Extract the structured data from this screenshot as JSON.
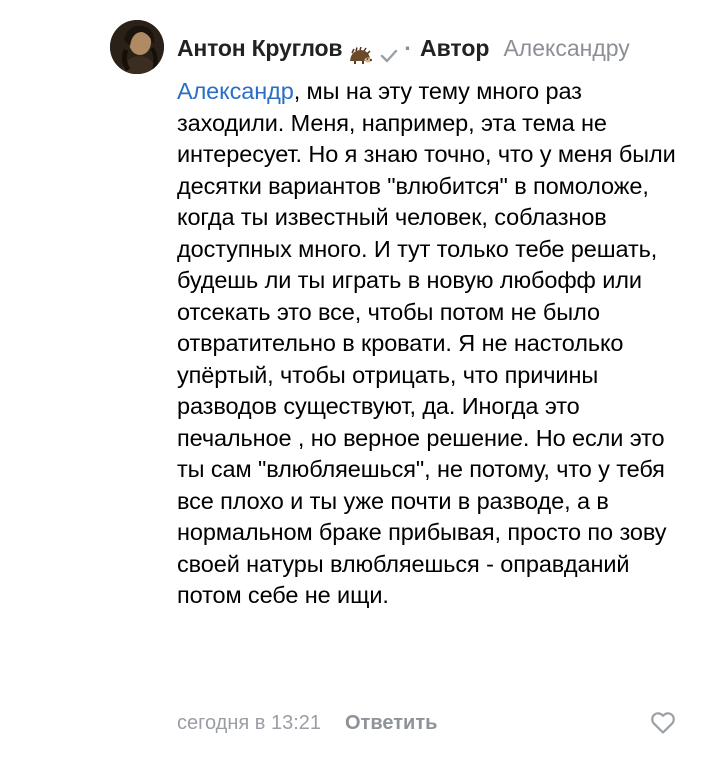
{
  "comment": {
    "author": "Антон Круглов",
    "author_badge": "Автор",
    "reply_to": "Александру",
    "mention": "Александр",
    "text": ", мы на эту тему много раз заходили. Меня, например, эта тема не интересует. Но я знаю точно, что у меня были десятки вариантов \"влюбится\" в помоложе, когда ты известный человек, соблазнов доступных много. И тут только тебе решать, будешь ли ты играть в новую любофф или отсекать это все, чтобы потом не было отвратительно в кровати. Я не настолько упёртый, чтобы отрицать, что причины разводов существуют, да. Иногда это печальное , но верное решение. Но если это ты   сам \"влюбляешься\", не потому, что у тебя все плохо и ты уже почти в разводе, а в нормальном браке прибывая, просто по зову своей натуры влюбляешься - оправданий потом себе не ищи.",
    "timestamp": "сегодня в 13:21",
    "reply_label": "Ответить"
  },
  "icons": {
    "avatar": "avatar",
    "hedgehog": "hedgehog-emoji-icon",
    "verified": "verified-check-icon",
    "like": "heart-outline-icon"
  },
  "colors": {
    "link": "#2a6ec7",
    "muted": "#8c9096",
    "text": "#000000"
  }
}
